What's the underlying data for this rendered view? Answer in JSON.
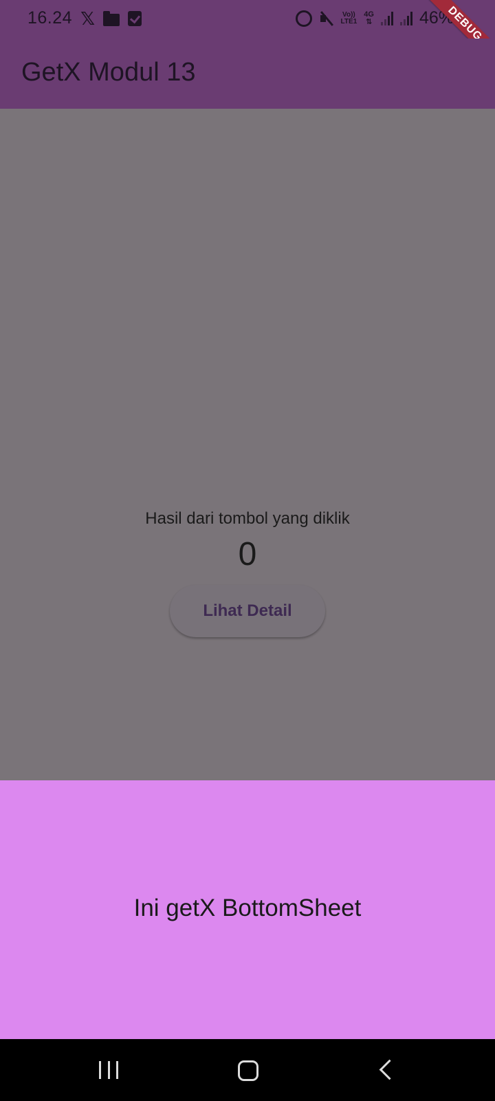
{
  "status_bar": {
    "time": "16.24",
    "volte_line1": "Vo))",
    "volte_line2": "LTE1",
    "network": "4G",
    "battery": "46%",
    "icons": [
      "x-app-icon",
      "folder-icon",
      "task-check-icon",
      "alarm-icon",
      "mute-icon",
      "signal-icon",
      "signal-icon"
    ]
  },
  "debug_banner": "DEBUG",
  "app_bar": {
    "title": "GetX Modul 13"
  },
  "main": {
    "result_label": "Hasil dari tombol yang diklik",
    "counter": "0",
    "detail_button": "Lihat Detail"
  },
  "bottom_sheet": {
    "text": "Ini getX BottomSheet"
  },
  "nav_bar": {
    "buttons": [
      "recents-icon",
      "home-icon",
      "back-icon"
    ]
  },
  "colors": {
    "app_bar": "#6a3c72",
    "scrim_content": "#7a7479",
    "bottom_sheet": "#dc88ef",
    "debug_banner": "#a22a3a",
    "button_text": "#3e2a52"
  }
}
